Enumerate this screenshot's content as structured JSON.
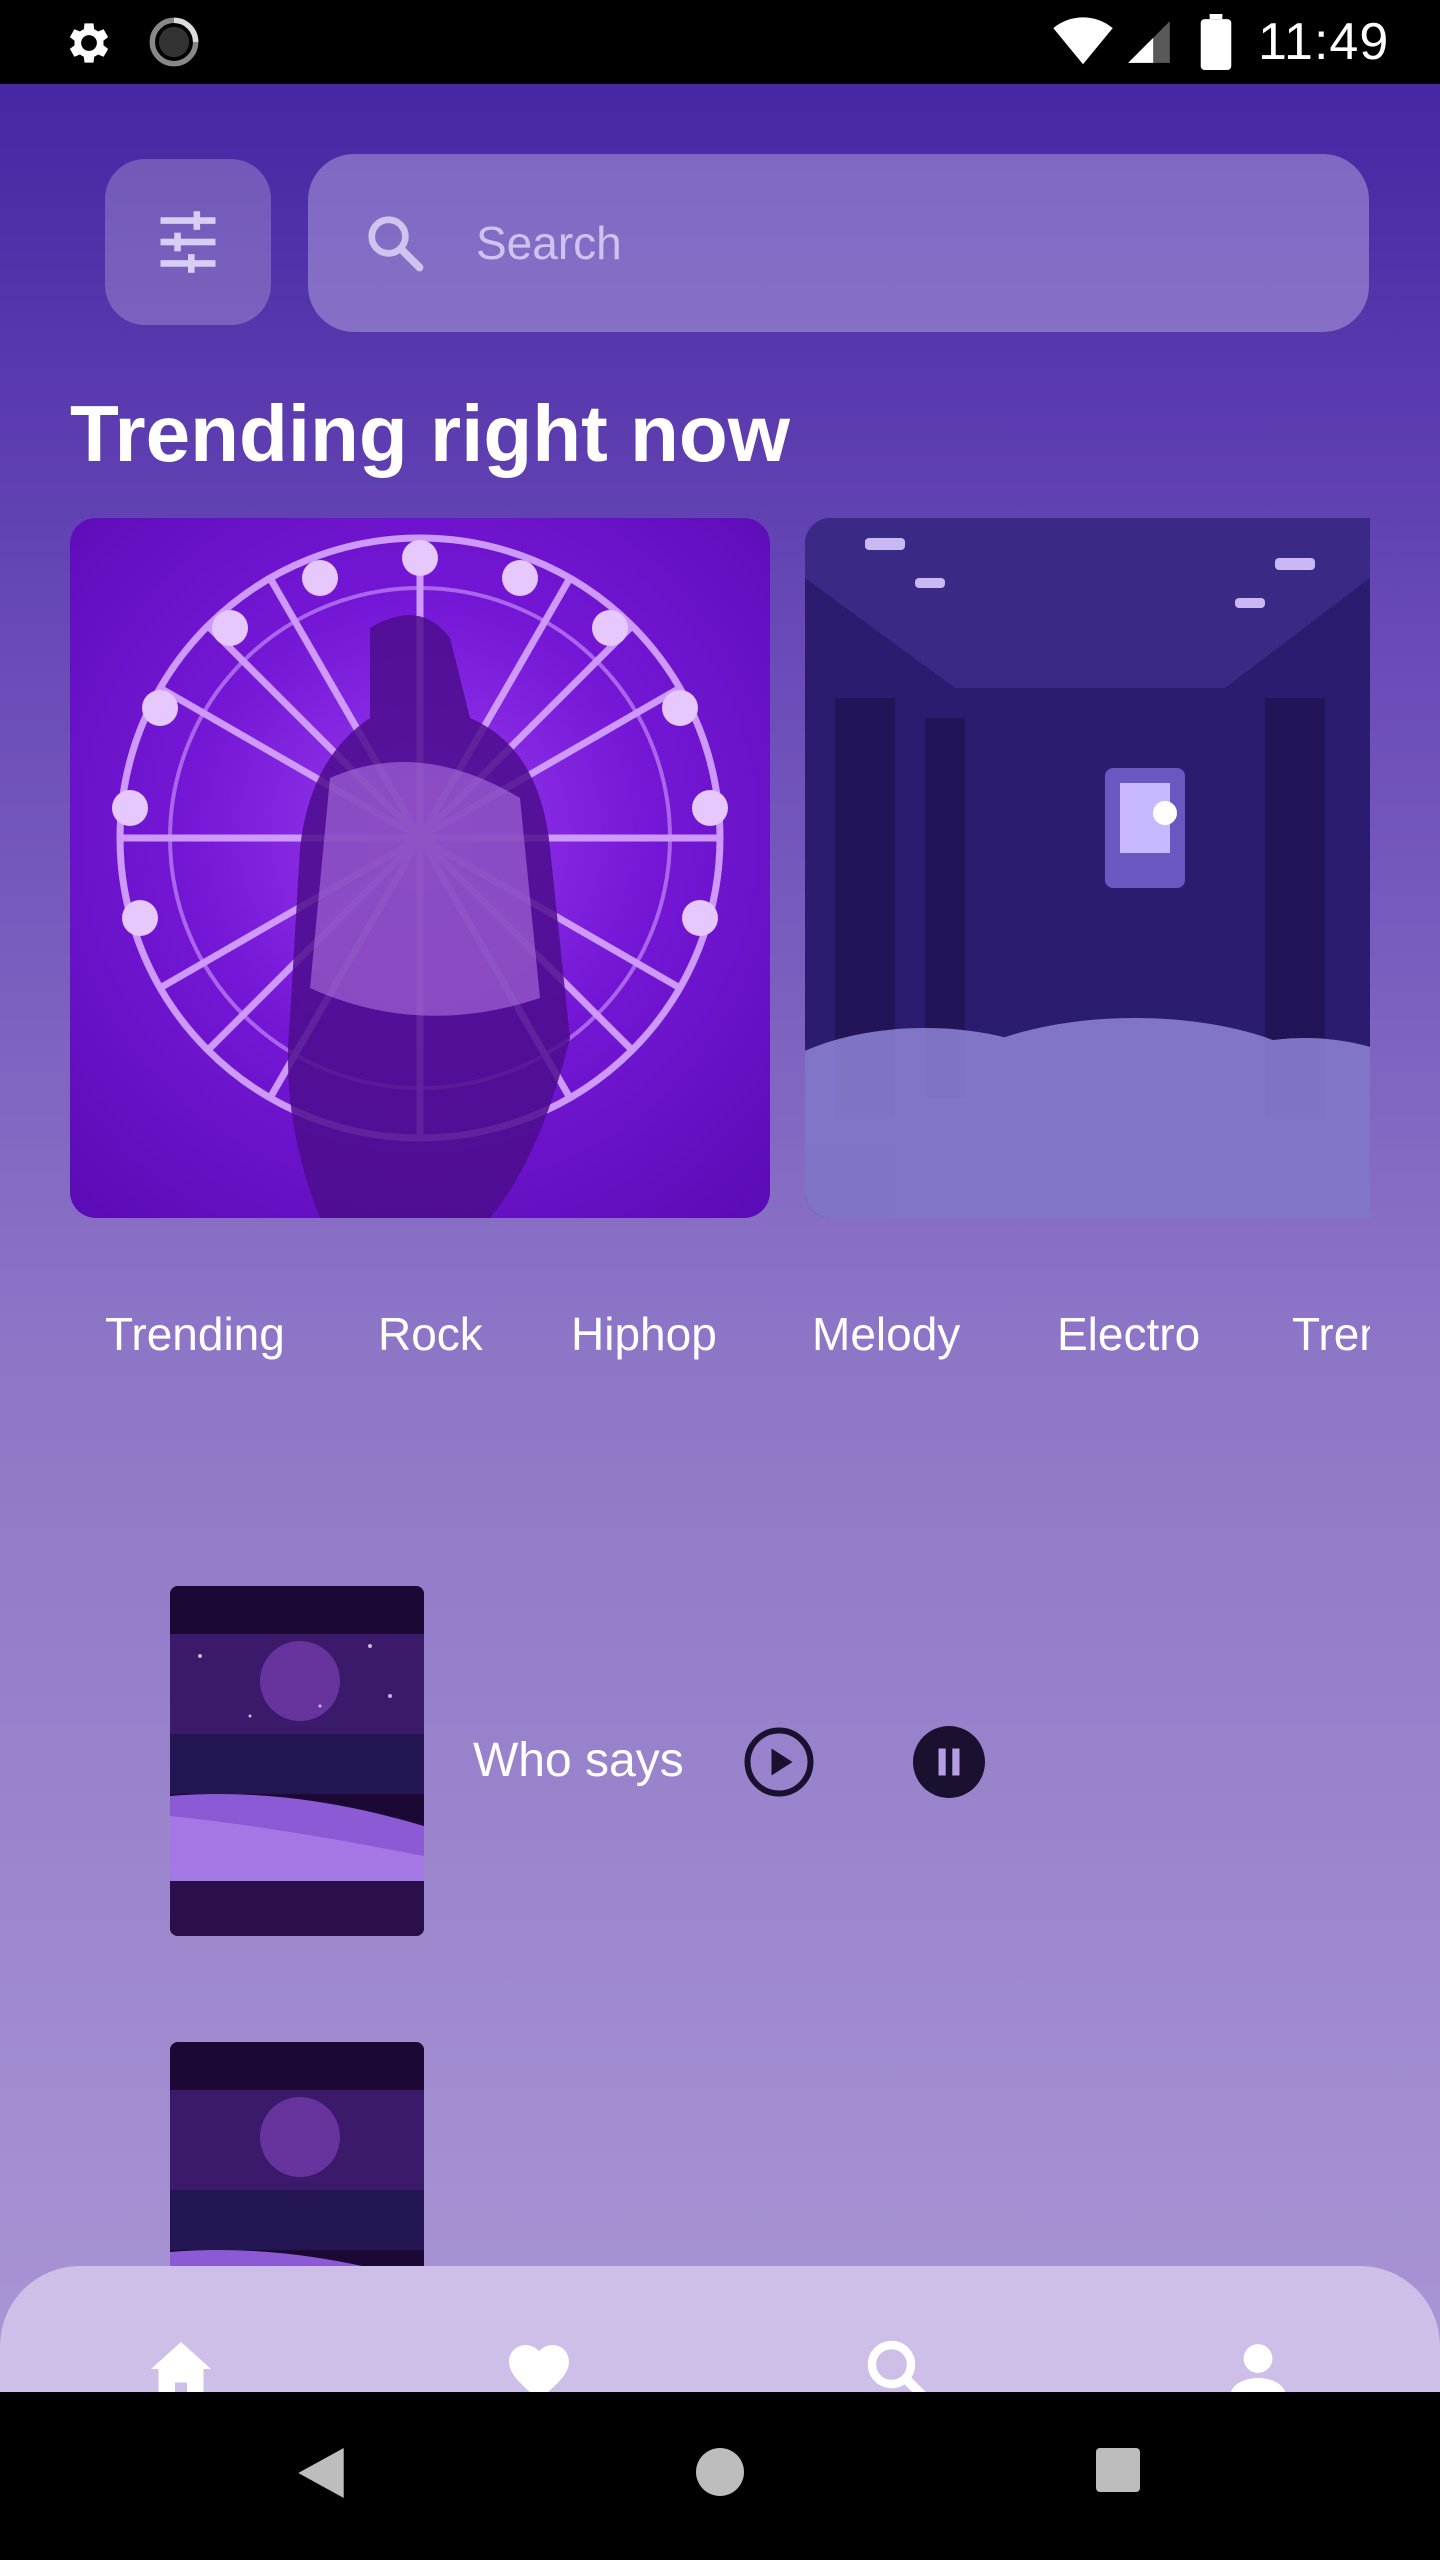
{
  "status_bar": {
    "time": "11:49",
    "icons": [
      "gear-icon",
      "spinner-icon",
      "wifi-icon",
      "signal-icon",
      "battery-icon"
    ]
  },
  "search": {
    "placeholder": "Search"
  },
  "section_title": "Trending right now",
  "cards": [
    {
      "name": "ferris-wheel-artwork"
    },
    {
      "name": "train-clouds-artwork"
    }
  ],
  "categories": [
    "Trending",
    "Rock",
    "Hiphop",
    "Melody",
    "Electro",
    "Trending"
  ],
  "tracks": [
    {
      "title": "Who says"
    },
    {
      "title": ""
    }
  ],
  "bottom_nav": {
    "items": [
      "home-icon",
      "heart-icon",
      "search-icon",
      "person-icon"
    ]
  },
  "colors": {
    "bg_top": "#4727a3",
    "bg_bottom": "#a996d4",
    "nav_bg": "#cdbfe8",
    "icon_dark": "#1a1030",
    "text": "#ffffff"
  }
}
